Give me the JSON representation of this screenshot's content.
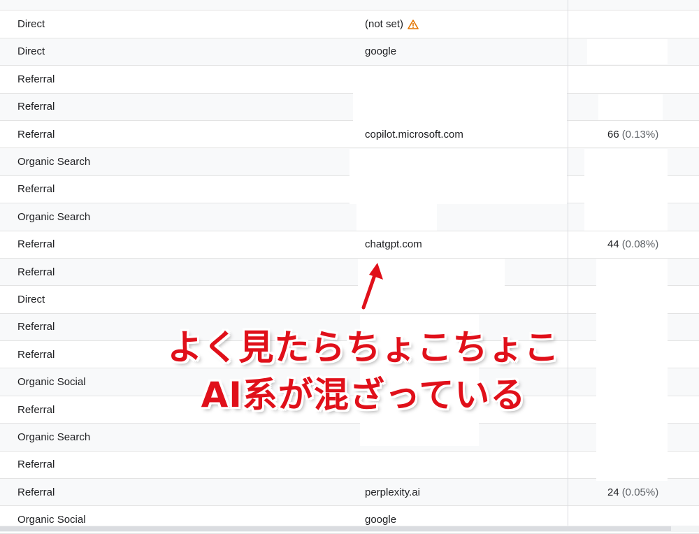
{
  "rows": [
    {
      "channel": "",
      "source": "",
      "metric": "",
      "pct": ""
    },
    {
      "channel": "Direct",
      "source": "(not set)",
      "warn": true,
      "metric": "",
      "pct": ""
    },
    {
      "channel": "Direct",
      "source": "google",
      "metric": "",
      "pct": ""
    },
    {
      "channel": "Referral",
      "source": "",
      "metric": "",
      "pct": ""
    },
    {
      "channel": "Referral",
      "source": "",
      "metric": "",
      "pct": ""
    },
    {
      "channel": "Referral",
      "source": "copilot.microsoft.com",
      "metric": "66",
      "pct": "(0.13%)"
    },
    {
      "channel": "Organic Search",
      "source": "",
      "metric": "",
      "pct": ""
    },
    {
      "channel": "Referral",
      "source": "",
      "metric": "",
      "pct": ""
    },
    {
      "channel": "Organic Search",
      "source": "",
      "metric": "",
      "pct": ""
    },
    {
      "channel": "Referral",
      "source": "chatgpt.com",
      "metric": "44",
      "pct": "(0.08%)"
    },
    {
      "channel": "Referral",
      "source": "",
      "metric": "",
      "pct": ""
    },
    {
      "channel": "Direct",
      "source": "",
      "metric": "",
      "pct": ""
    },
    {
      "channel": "Referral",
      "source": "",
      "metric": "",
      "pct": ""
    },
    {
      "channel": "Referral",
      "source": "",
      "metric": "",
      "pct": ""
    },
    {
      "channel": "Organic Social",
      "source": "",
      "metric": "",
      "pct": ""
    },
    {
      "channel": "Referral",
      "source": "",
      "metric": "",
      "pct": ""
    },
    {
      "channel": "Organic Search",
      "source": "",
      "metric": "",
      "pct": ""
    },
    {
      "channel": "Referral",
      "source": "",
      "metric": "",
      "pct": ""
    },
    {
      "channel": "Referral",
      "source": "perplexity.ai",
      "metric": "24",
      "pct": "(0.05%)"
    },
    {
      "channel": "Organic Social",
      "source": "google",
      "metric": "",
      "pct": ""
    }
  ],
  "annotation": {
    "line1": "よく見たらちょこちょこ",
    "line2": "AI系が混ざっている"
  },
  "colors": {
    "annotation": "#e0101a",
    "warning": "#e37400",
    "row_alt": "#f8f9fa"
  }
}
